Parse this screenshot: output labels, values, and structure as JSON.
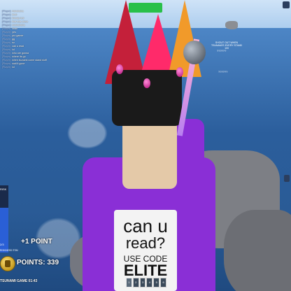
{
  "hud": {
    "risk_label": "RISK",
    "risk_value": "2/3",
    "risk_caption": "RISKINESS ITEM",
    "risk_level_fraction": 0.67,
    "bonus_text": "+1 POINT",
    "points_text": "POINTS: 339",
    "survival_text": "TSUNAMI GAME 01:43"
  },
  "billboard": {
    "line1": "SHOUT OUT WHEN TSUNAMI'S EVERY STAND 100",
    "line2": "??????",
    "line3": "??????"
  },
  "chat": [
    {
      "name": "[Player]:",
      "text": "Hahahaha"
    },
    {
      "name": "[Player]:",
      "text": "bruh"
    },
    {
      "name": "[Player]:",
      "text": "bloody hell"
    },
    {
      "name": "[Player]:",
      "text": "that was close"
    },
    {
      "name": "[Player]:",
      "text": "woahahaha"
    },
    {
      "name": "[Player]:",
      "text": "lmao"
    },
    {
      "name": "[Player]:",
      "text": "yes"
    },
    {
      "name": "[Player]:",
      "text": "pro gamer"
    },
    {
      "name": "[Player]:",
      "text": "gg"
    },
    {
      "name": "[Player]:",
      "text": "ez"
    },
    {
      "name": "[Player]:",
      "text": "can u read"
    },
    {
      "name": "[Player]:",
      "text": "lol"
    },
    {
      "name": "[Player]:",
      "text": "who are gonna"
    },
    {
      "name": "[Player]:",
      "text": "where its go"
    },
    {
      "name": "[Player]:",
      "text": "when tsunami come stand stuff"
    },
    {
      "name": "[Player]:",
      "text": "wait it gone"
    },
    {
      "name": "[Player]:",
      "text": "lol"
    }
  ],
  "shirt": {
    "line1": "can u",
    "line2": "read?",
    "line3": "USE CODE",
    "line4": "ELITE"
  },
  "hotbar": [
    {
      "label": "1"
    },
    {
      "label": "2"
    },
    {
      "label": "3"
    },
    {
      "label": "4"
    },
    {
      "label": "5"
    },
    {
      "label": "6"
    }
  ],
  "colors": {
    "health_bar": "#29c04a",
    "shirt": "#8a2fd6",
    "ocean": "#2f6fb0"
  }
}
